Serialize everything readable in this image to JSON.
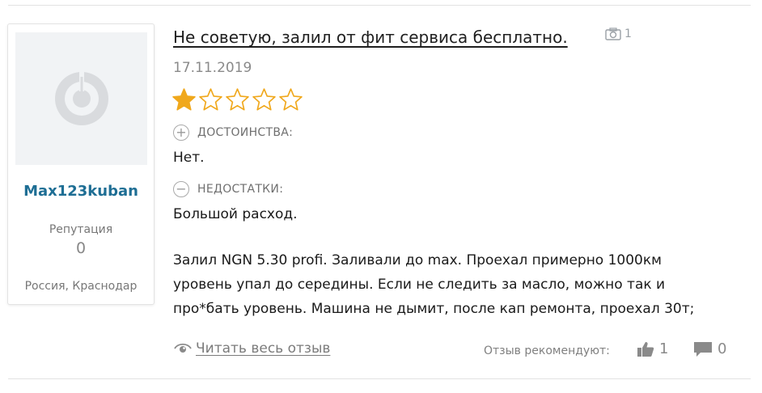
{
  "review": {
    "title": "Не советую, залил от фит сервиса бесплатно.",
    "photo_count": "1",
    "date": "17.11.2019",
    "rating": 1,
    "rating_max": 5,
    "pros_label": "ДОСТОИНСТВА:",
    "pros_text": "Нет.",
    "cons_label": "НЕДОСТАТКИ:",
    "cons_text": "Большой расход.",
    "body_lines": [
      "Залил NGN 5.30 profi. Заливали до max. Проехал примерно 1000км",
      "уровень упал до середины. Если не следить за масло, можно так и",
      "про*бать уровень. Машина не дымит, после кап ремонта, проехал 30т;"
    ],
    "read_more": "Читать весь отзыв",
    "recommend_label": "Отзыв рекомендуют:",
    "likes": "1",
    "comments": "0"
  },
  "user": {
    "username": "Max123kuban",
    "reputation_label": "Репутация",
    "reputation_value": "0",
    "location": "Россия, Краснодар"
  },
  "icons": {
    "avatar": "default-avatar-icon",
    "photo": "camera-icon",
    "pros": "plus-circle-icon",
    "cons": "minus-circle-icon",
    "read_more": "eye-icon",
    "likes": "thumbs-up-icon",
    "comments": "comment-icon"
  },
  "colors": {
    "star_filled": "#f0a81c",
    "star_empty_outline": "#f0a81c",
    "username": "#1e6e94"
  }
}
